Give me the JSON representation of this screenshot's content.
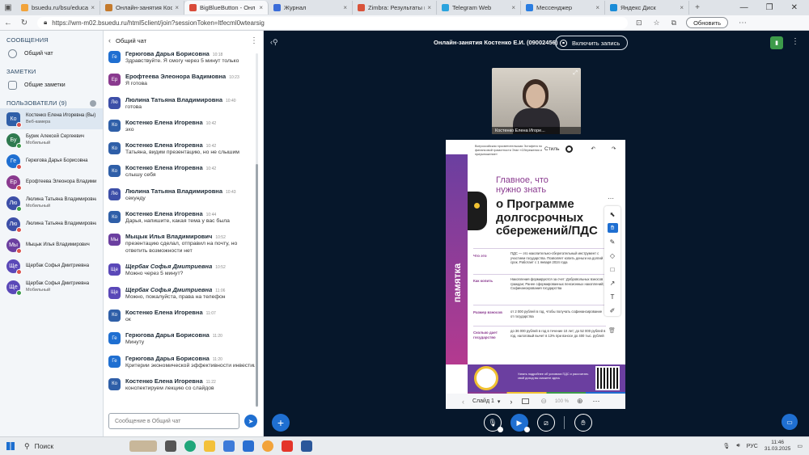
{
  "browser": {
    "tabs": [
      {
        "label": "bsuedu.ru/bsu/education/",
        "color": "#f2a33a",
        "active": false
      },
      {
        "label": "Онлайн-занятия Костенко",
        "color": "#c47a2c",
        "active": false
      },
      {
        "label": "BigBlueButton - Онл",
        "color": "#d94b3a",
        "active": true
      },
      {
        "label": "Журнал",
        "color": "#3a6cd9",
        "active": false
      },
      {
        "label": "Zimbra: Результаты поиск",
        "color": "#d9533a",
        "active": false
      },
      {
        "label": "Telegram Web",
        "color": "#2aa3de",
        "active": false
      },
      {
        "label": "Мессенджер",
        "color": "#2a7de1",
        "active": false
      },
      {
        "label": "Яндекс Диск",
        "color": "#1a8cd8",
        "active": false
      }
    ],
    "url": "https://wm-m02.bsuedu.ru/html5client/join?sessionToken=ltfecml0wtearsig",
    "update_label": "Обновить"
  },
  "left_panel": {
    "messages_header": "СООБЩЕНИЯ",
    "public_chat": "Общий чат",
    "notes_header": "ЗАМЕТКИ",
    "shared_notes": "Общие заметки",
    "users_header": "ПОЛЬЗОВАТЕЛИ (9)",
    "users": [
      {
        "initials": "Ко",
        "name": "Костенко Елена Игоревна (Вы)",
        "sub": "Веб-камера",
        "color": "#2f5fa8",
        "me": true
      },
      {
        "initials": "Бу",
        "name": "Бурик Алексей Сергеевич",
        "sub": "Мобильный",
        "color": "#2f7a4f",
        "me": false
      },
      {
        "initials": "Ге",
        "name": "Герюгова Дарья Борисовна",
        "sub": "",
        "color": "#1f6fd1",
        "me": false
      },
      {
        "initials": "Ер",
        "name": "Ерофтеева Элеонора Владимировна",
        "sub": "",
        "color": "#8a3a8f",
        "me": false
      },
      {
        "initials": "Лю",
        "name": "Люлина Татьяна Владимировна",
        "sub": "Мобильный",
        "color": "#3d4fa8",
        "me": false
      },
      {
        "initials": "Лю",
        "name": "Люлина Татьяна Владимировна",
        "sub": "",
        "color": "#3d4fa8",
        "me": false
      },
      {
        "initials": "Мы",
        "name": "Мыцык Илья Владимирович",
        "sub": "",
        "color": "#6b3fa0",
        "me": false
      },
      {
        "initials": "Ще",
        "name": "Щербак Софья Дмитриевна",
        "sub": "",
        "color": "#5a48b8",
        "me": false
      },
      {
        "initials": "Ще",
        "name": "Щербак Софья Дмитриевна",
        "sub": "Мобильный",
        "color": "#5a48b8",
        "me": false
      }
    ]
  },
  "chat": {
    "title": "Общий чат",
    "placeholder": "Сообщение в Общий чат",
    "messages": [
      {
        "initials": "Ге",
        "color": "#1f6fd1",
        "name": "Герюгова Дарья Борисовна",
        "time": "10:18",
        "text": "Здравствуйте. Я смогу через 5 минут только",
        "italic": false
      },
      {
        "initials": "Ер",
        "color": "#8a3a8f",
        "name": "Ерофтеева Элеонора Вадимовна",
        "time": "10:23",
        "text": "Я готова",
        "italic": false
      },
      {
        "initials": "Лю",
        "color": "#3d4fa8",
        "name": "Люлина Татьяна Владимировна",
        "time": "10:40",
        "text": "готова",
        "italic": false
      },
      {
        "initials": "Ко",
        "color": "#2f5fa8",
        "name": "Костенко Елена Игоревна",
        "time": "10:42",
        "text": "эхо",
        "italic": false
      },
      {
        "initials": "Ко",
        "color": "#2f5fa8",
        "name": "Костенко Елена Игоревна",
        "time": "10:42",
        "text": "Татьяна, видим презентацию, но не слышим",
        "italic": false
      },
      {
        "initials": "Ко",
        "color": "#2f5fa8",
        "name": "Костенко Елена Игоревна",
        "time": "10:42",
        "text": "слышу себя",
        "italic": false
      },
      {
        "initials": "Лю",
        "color": "#3d4fa8",
        "name": "Люлина Татьяна Владимировна",
        "time": "10:43",
        "text": "секунду",
        "italic": false
      },
      {
        "initials": "Ко",
        "color": "#2f5fa8",
        "name": "Костенко Елена Игоревна",
        "time": "10:44",
        "text": "Дарья, напишите, какая тема у вас была",
        "italic": false
      },
      {
        "initials": "Мы",
        "color": "#6b3fa0",
        "name": "Мыцык Илья Владимирович",
        "time": "10:52",
        "text": "презентацию сделал, отправил на почту, но ответить возможности нет",
        "italic": false
      },
      {
        "initials": "Ще",
        "color": "#5a48b8",
        "name": "Щербак Софья Дмитриевна",
        "time": "10:52",
        "text": "Можно через 5 минут?",
        "italic": true
      },
      {
        "initials": "Ще",
        "color": "#5a48b8",
        "name": "Щербак Софья Дмитриевна",
        "time": "11:06",
        "text": "Можно, пожалуйста, права на телефон",
        "italic": true
      },
      {
        "initials": "Ко",
        "color": "#2f5fa8",
        "name": "Костенко Елена Игоревна",
        "time": "11:07",
        "text": "ок",
        "italic": false
      },
      {
        "initials": "Ге",
        "color": "#1f6fd1",
        "name": "Герюгова Дарья Борисовна",
        "time": "11:20",
        "text": "Минуту",
        "italic": false
      },
      {
        "initials": "Ге",
        "color": "#1f6fd1",
        "name": "Герюгова Дарья Борисовна",
        "time": "11:20",
        "text": "Критерии экономической эффективности инвестиций",
        "italic": false
      },
      {
        "initials": "Ко",
        "color": "#2f5fa8",
        "name": "Костенко Елена Игоревна",
        "time": "11:22",
        "text": "конспектируем лекцию со слайдов",
        "italic": false
      }
    ]
  },
  "stage": {
    "meeting_title": "Онлайн-занятия Костенко Е.И. (09002456)",
    "record_label": "Включить запись",
    "video_name": "Костенко Елена Игоре...",
    "slide": {
      "header": "Всероссийская просветительская Эстафета по финансовой грамотности Этап «Сбережения и приумножение»",
      "style_label": "Стиль",
      "heading_small": "Главное, что нужно знать",
      "heading_big": "о Программе долгосрочных сбережений/ПДС",
      "vertical_word": "памятка",
      "rows": [
        {
          "label": "Что это",
          "text": "ПДС — это накопительно-сберегательный инструмент с участием государства. Позволяет копить деньги на долгий срок. Работает с 1 января 2024 года"
        },
        {
          "label": "Как копить",
          "text": "Накопления формируются за счет: Добровольных взносов граждан; Ранее сформированных пенсионных накоплений; Софинансирования государства"
        },
        {
          "label": "Размер взносов",
          "text": "от 2 000 рублей в год, чтобы получать софинансирование от государства"
        },
        {
          "label": "Сколько дает государство",
          "text": "до 36 000 рублей в год в течение 10 лет; до 52 000 рублей в год, налоговый вычет в 13% при взносе до 400 тыс. рублей"
        }
      ],
      "footer_text": "Узнать подробнее об условиях ПДС и рассчитать свой доход вы сможете здесь",
      "slide_label": "Слайд 1",
      "zoom": "100 %"
    }
  },
  "taskbar": {
    "search": "Поиск",
    "lang": "РУС",
    "time": "11:46",
    "date": "31.03.2025"
  }
}
